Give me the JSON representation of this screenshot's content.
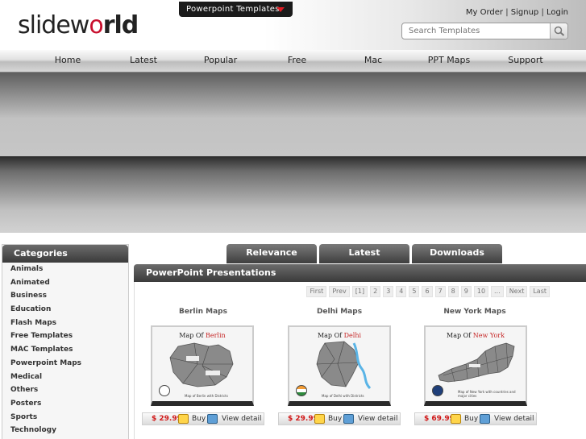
{
  "header": {
    "logo_part1": "slidew",
    "logo_o": "o",
    "logo_part2": "rld",
    "templates_dropdown": "Powerpoint Templates",
    "top_links": [
      "My Order",
      "Signup",
      "Login"
    ],
    "search_placeholder": "Search Templates"
  },
  "nav": [
    "Home",
    "Latest",
    "Popular",
    "Free",
    "Mac",
    "PPT Maps",
    "Support"
  ],
  "sidebar": {
    "title": "Categories",
    "items": [
      "Animals",
      "Animated",
      "Business",
      "Education",
      "Flash Maps",
      "Free Templates",
      "MAC Templates",
      "Powerpoint Maps",
      "Medical",
      "Others",
      "Posters",
      "Sports",
      "Technology"
    ]
  },
  "tabs": [
    "Relevance",
    "Latest",
    "Downloads"
  ],
  "panel": {
    "title": "PowerPoint Presentations",
    "pager": [
      "First",
      "Prev",
      "[1]",
      "2",
      "3",
      "4",
      "5",
      "6",
      "7",
      "8",
      "9",
      "10",
      "...",
      "Next",
      "Last"
    ]
  },
  "products": [
    {
      "title": "Berlin Maps",
      "thumb_prefix": "Map Of ",
      "thumb_city": "Berlin",
      "caption": "Map of Berlin with Districts",
      "price": "$ 29.99",
      "buy": "Buy",
      "view": "View detail"
    },
    {
      "title": "Delhi Maps",
      "thumb_prefix": "Map Of ",
      "thumb_city": "Delhi",
      "caption": "Map of Delhi with Districts",
      "price": "$ 29.99",
      "buy": "Buy",
      "view": "View detail"
    },
    {
      "title": "New York Maps",
      "thumb_prefix": "Map Of ",
      "thumb_city": "New York",
      "caption": "Map of New York with countries and major cities",
      "price": "$ 69.99",
      "buy": "Buy",
      "view": "View detail"
    }
  ],
  "icons": {
    "search": "magnifier-icon",
    "cart": "cart-icon",
    "zoom": "zoom-icon",
    "dropdown": "caret-down-icon"
  },
  "colors": {
    "brand_red": "#c8102e",
    "price_red": "#d01818",
    "dark_bar": "#3a3a3a"
  }
}
